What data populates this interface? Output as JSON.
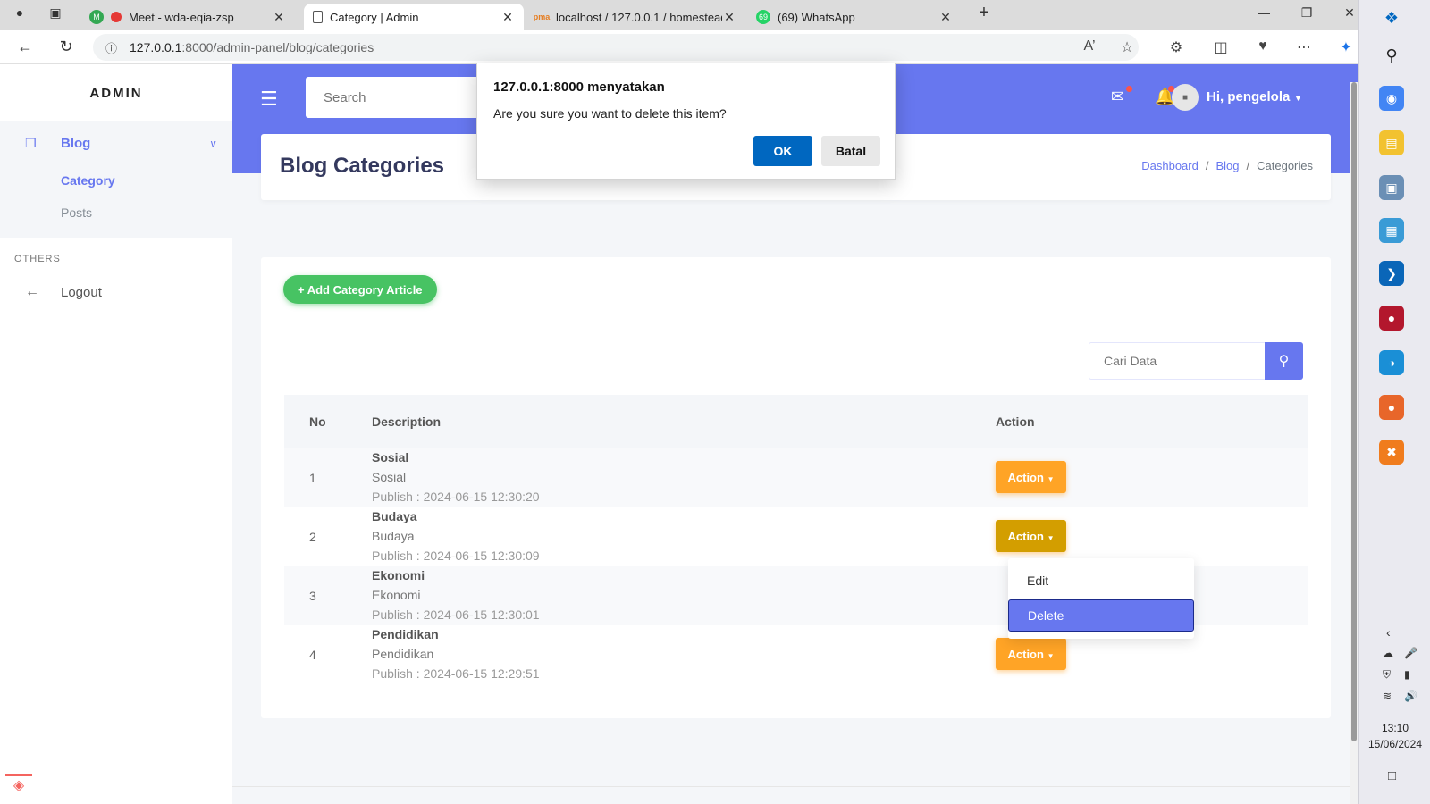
{
  "browser": {
    "tabs": [
      {
        "label": "Meet - wda-eqia-zsp",
        "active": false
      },
      {
        "label": "Category | Admin",
        "active": true
      },
      {
        "label": "localhost / 127.0.0.1 / homestead",
        "active": false
      },
      {
        "label": "(69) WhatsApp",
        "active": false
      }
    ],
    "whatsapp_badge": "69",
    "url_host": "127.0.0.1",
    "url_path": ":8000/admin-panel/blog/categories"
  },
  "dialog": {
    "title": "127.0.0.1:8000 menyatakan",
    "message": "Are you sure you want to delete this item?",
    "ok_label": "OK",
    "cancel_label": "Batal"
  },
  "sidebar": {
    "brand": "ADMIN",
    "blog_label": "Blog",
    "items": [
      {
        "label": "Category",
        "active": true
      },
      {
        "label": "Posts",
        "active": false
      }
    ],
    "section_label": "OTHERS",
    "logout_label": "Logout"
  },
  "topbar": {
    "search_placeholder": "Search",
    "user_greeting": "Hi, pengelola"
  },
  "header": {
    "title": "Blog Categories",
    "breadcrumb": [
      "Dashboard",
      "Blog",
      "Categories"
    ]
  },
  "content": {
    "add_button_label": "+ Add Category Article",
    "search_placeholder": "Cari Data",
    "columns": [
      "No",
      "Description",
      "Action"
    ],
    "rows": [
      {
        "no": "1",
        "title": "Sosial",
        "subtitle": "Sosial",
        "date": "Publish : 2024-06-15 12:30:20",
        "action": "Action"
      },
      {
        "no": "2",
        "title": "Budaya",
        "subtitle": "Budaya",
        "date": "Publish : 2024-06-15 12:30:09",
        "action": "Action"
      },
      {
        "no": "3",
        "title": "Ekonomi",
        "subtitle": "Ekonomi",
        "date": "Publish : 2024-06-15 12:30:01",
        "action": "Action"
      },
      {
        "no": "4",
        "title": "Pendidikan",
        "subtitle": "Pendidikan",
        "date": "Publish : 2024-06-15 12:29:51",
        "action": "Action"
      }
    ],
    "dropdown": {
      "edit_label": "Edit",
      "delete_label": "Delete"
    }
  },
  "system": {
    "time": "13:10",
    "date": "15/06/2024"
  },
  "colors": {
    "primary": "#6777ef",
    "success": "#47c363",
    "warning": "#ffa426",
    "dialog_ok": "#0067c0"
  },
  "icons": {
    "sidebar_blog": "copy-icon",
    "logout": "arrow-left-icon",
    "mail": "envelope-icon",
    "bell": "bell-icon",
    "search": "search-icon"
  }
}
